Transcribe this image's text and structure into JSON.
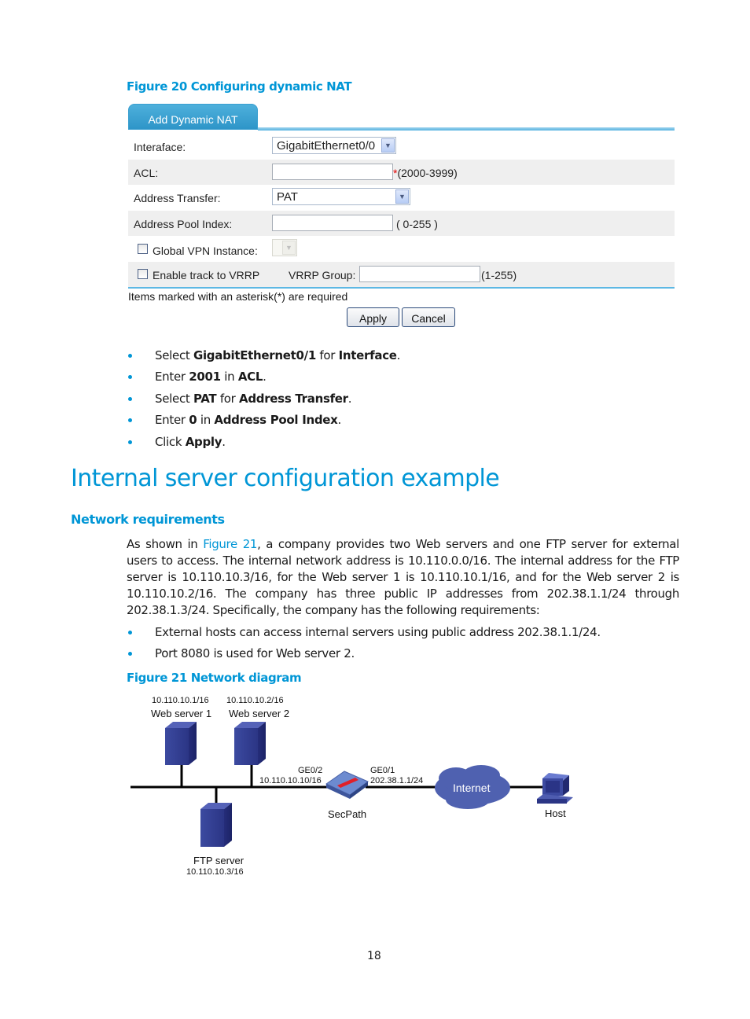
{
  "figure20": {
    "caption": "Figure 20 Configuring dynamic NAT",
    "tab_label": "Add Dynamic NAT",
    "interface": {
      "label": "Interaface:",
      "value": "GigabitEthernet0/0"
    },
    "acl": {
      "label": "ACL:",
      "value": "",
      "required_mark": "*",
      "range": "(2000-3999)"
    },
    "address_transfer": {
      "label": "Address Transfer:",
      "value": "PAT"
    },
    "address_pool_index": {
      "label": "Address Pool Index:",
      "value": "",
      "range": "( 0-255 )"
    },
    "global_vpn_instance": {
      "label": "Global VPN Instance:",
      "checked": false,
      "value": ""
    },
    "enable_track_vrrp": {
      "label": "Enable track to VRRP",
      "checked": false
    },
    "vrrp_group": {
      "label": "VRRP Group:",
      "value": "",
      "range": "(1-255)"
    },
    "required_note": "Items marked with an asterisk(*) are required",
    "apply_label": "Apply",
    "cancel_label": "Cancel"
  },
  "steps": [
    {
      "pre": "Select ",
      "b1": "GigabitEthernet0/1",
      "mid": " for ",
      "b2": "Interface",
      "post": "."
    },
    {
      "pre": "Enter ",
      "b1": "2001",
      "mid": " in ",
      "b2": "ACL",
      "post": "."
    },
    {
      "pre": "Select ",
      "b1": "PAT",
      "mid": " for ",
      "b2": "Address Transfer",
      "post": "."
    },
    {
      "pre": "Enter ",
      "b1": "0",
      "mid": " in ",
      "b2": "Address Pool Index",
      "post": "."
    },
    {
      "pre": "Click ",
      "b1": "Apply",
      "mid": "",
      "b2": "",
      "post": "."
    }
  ],
  "section": {
    "title": "Internal server configuration example",
    "subtitle": "Network requirements",
    "para_pre": "As shown in ",
    "para_link": "Figure 21",
    "para_post": ", a company provides two Web servers and one FTP server for external users to access. The internal network address is 10.110.0.0/16. The internal address for the FTP server is 10.110.10.3/16, for the Web server 1 is 10.110.10.1/16, and for the Web server 2 is 10.110.10.2/16. The company has three public IP addresses from 202.38.1.1/24 through 202.38.1.3/24. Specifically, the company has the following requirements:",
    "requirements": [
      "External hosts can access internal servers using public address 202.38.1.1/24.",
      "Port 8080 is used for Web server 2."
    ]
  },
  "figure21": {
    "caption": "Figure 21 Network diagram",
    "web1": {
      "ip": "10.110.10.1/16",
      "name": "Web server 1"
    },
    "web2": {
      "ip": "10.110.10.2/16",
      "name": "Web server 2"
    },
    "ftp": {
      "name": "FTP server",
      "ip": "10.110.10.3/16"
    },
    "secpath": {
      "name": "SecPath",
      "if_in": "GE0/2",
      "ip_in": "10.110.10.10/16",
      "if_out": "GE0/1",
      "ip_out": "202.38.1.1/24"
    },
    "internet": "Internet",
    "host": "Host"
  },
  "page_number": "18"
}
